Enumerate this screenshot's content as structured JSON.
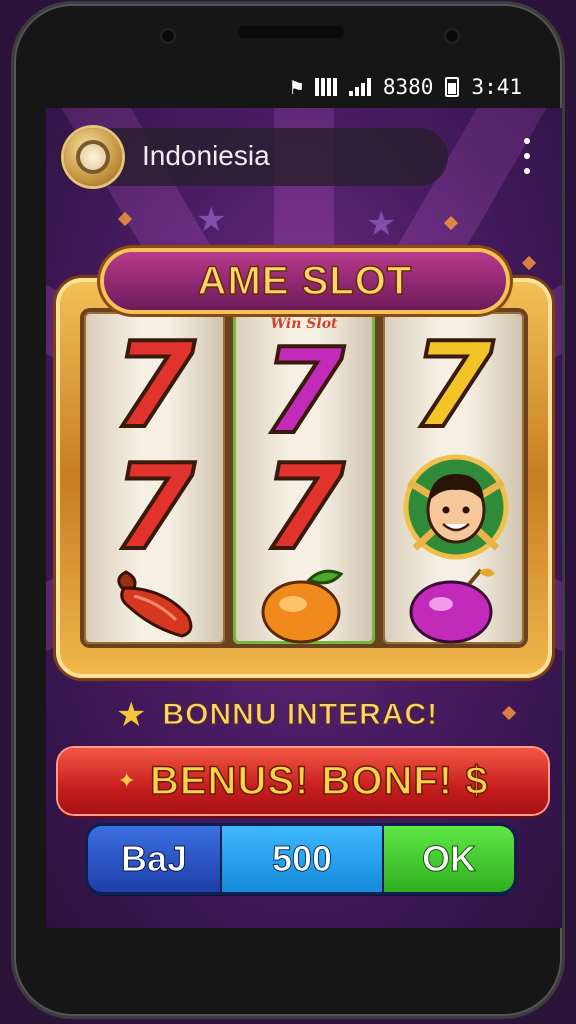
{
  "status_bar": {
    "icons": [
      "notification-icon",
      "signal-icon",
      "wifi-signal-icon",
      "battery-icon"
    ],
    "battery_text": "8380",
    "time": "3:41"
  },
  "app_bar": {
    "title": "Indoniesia",
    "logo_icon": "coin-logo-icon",
    "menu_icon": "more-vert-icon"
  },
  "game": {
    "title": "AME SLOT",
    "reels": [
      {
        "label": "",
        "symbols": [
          "seven-red-fire",
          "seven-red",
          "chili-pepper"
        ]
      },
      {
        "label": "Win Slot",
        "symbols": [
          "seven-magenta",
          "seven-red",
          "orange-fruit"
        ]
      },
      {
        "label": "",
        "symbols": [
          "seven-yellow-flower",
          "character-face",
          "plum-fruit"
        ]
      }
    ]
  },
  "bonus_text": "BONNU INTERAC!",
  "bonus_button": {
    "label": "BENUS! BONF! $",
    "icon": "sparkle-icon"
  },
  "controls": {
    "bet_label": "BaJ",
    "amount": "500",
    "ok_label": "OK"
  },
  "colors": {
    "background": "#4a1c64",
    "gold": "#f3c255",
    "red_button": "#c71e1e",
    "blue": "#1d3fa8",
    "cyan": "#148ad8",
    "green": "#2fae1e"
  }
}
